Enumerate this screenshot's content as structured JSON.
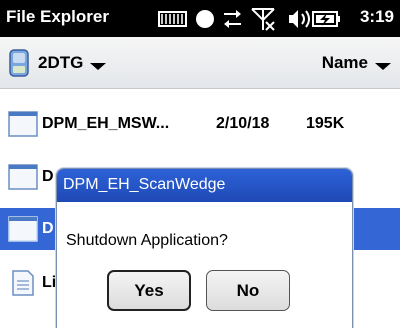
{
  "titlebar": {
    "app_title": "File Explorer",
    "clock": "3:19",
    "status_icons": [
      "battery-icon",
      "sync-icon",
      "signal-off-icon",
      "speaker-icon",
      "charging-icon"
    ]
  },
  "location": {
    "folder": "2DTG",
    "sort": "Name"
  },
  "files": [
    {
      "name": "DPM_EH_MSW...",
      "date": "2/10/18",
      "size": "195K"
    },
    {
      "name": "D",
      "date": "",
      "size": ""
    },
    {
      "name": "D",
      "date": "",
      "size": ""
    },
    {
      "name": "Li",
      "date": "",
      "size": ""
    }
  ],
  "dialog": {
    "title": "DPM_EH_ScanWedge",
    "message": "Shutdown Application?",
    "yes_label": "Yes",
    "no_label": "No"
  },
  "colors": {
    "selection": "#3466d6",
    "dialog_title": "#2d62d8"
  }
}
